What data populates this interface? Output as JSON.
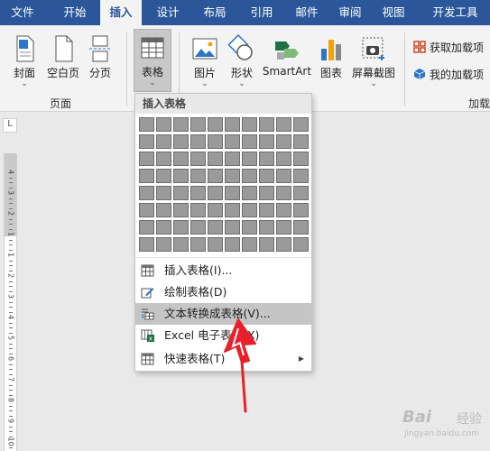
{
  "tabs": [
    "文件",
    "开始",
    "插入",
    "设计",
    "布局",
    "引用",
    "邮件",
    "审阅",
    "视图",
    "开发工具"
  ],
  "active_tab": "插入",
  "ribbon": {
    "cover": "封面",
    "blank_page": "空白页",
    "page_break": "分页",
    "pages_group": "页面",
    "table": "表格",
    "picture": "图片",
    "shapes": "形状",
    "smartart": "SmartArt",
    "chart": "图表",
    "screenshot": "屏幕截图",
    "get_addins": "获取加载项",
    "my_addins": "我的加载项",
    "addins_group": "加载"
  },
  "dropdown": {
    "header": "插入表格",
    "grid_cols": 10,
    "grid_rows": 8,
    "items": [
      {
        "label": "插入表格(I)...",
        "icon": "table-icon"
      },
      {
        "label": "绘制表格(D)",
        "icon": "pencil-table-icon"
      },
      {
        "label": "文本转换成表格(V)...",
        "icon": "text-to-table-icon"
      },
      {
        "label": "Excel 电子表格(X)",
        "icon": "excel-icon"
      },
      {
        "label": "快速表格(T)",
        "icon": "quick-table-icon"
      }
    ],
    "highlighted_index": 2
  },
  "ruler": {
    "corner": "L",
    "numbers": [
      "4",
      "3",
      "2",
      "1",
      "1",
      "2",
      "3",
      "4",
      "5",
      "6",
      "7",
      "8",
      "9",
      "10"
    ]
  },
  "watermark": {
    "brand": "Bai",
    "jingyan": "经验",
    "url": "jingyan.baidu.com"
  },
  "colors": {
    "ribbon_blue": "#2b579a",
    "annotation_red": "#e8202a",
    "excel_green": "#1e7145"
  }
}
